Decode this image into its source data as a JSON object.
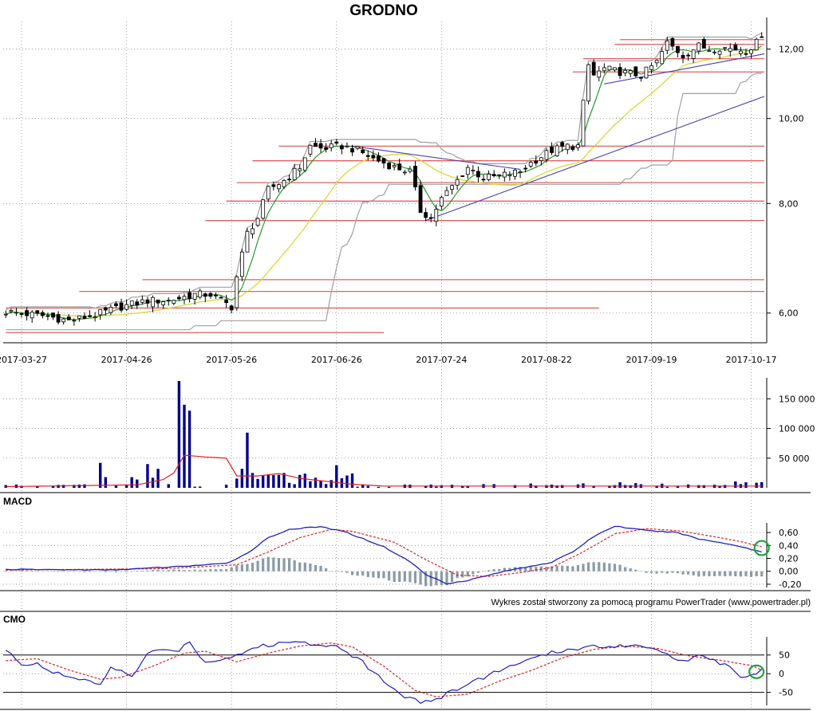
{
  "chart_data": {
    "title": "GRODNO",
    "credit": "Wykres został stworzony za pomocą programu PowerTrader (www.powertrader.pl)",
    "colors": {
      "candle_body_up": "#ffffff",
      "candle_body_down": "#000000",
      "sma_short": "#2a9a2a",
      "sma_long": "#d7d83a",
      "band": "#a0a0a0",
      "support_resistance": "#e06060",
      "trendline": "#4040b0",
      "volume_bar": "#00008b",
      "volume_avg": "#e02020",
      "macd_line": "#2020c0",
      "macd_signal": "#e02020",
      "histogram": "#8a9aa8",
      "marker_circle": "#20a040",
      "grid": "#8a8a8a"
    },
    "price_panel": {
      "type": "candlestick",
      "y_scale": "log",
      "ylim": [
        5.55,
        12.9
      ],
      "y_ticks": [
        6,
        8,
        10,
        12
      ],
      "y_tick_labels": [
        "6,00",
        "8,00",
        "10,00",
        "12,00"
      ],
      "x_tick_labels": [
        "2017-03-27",
        "2017-04-26",
        "2017-05-26",
        "2017-06-26",
        "2017-07-24",
        "2017-08-22",
        "2017-09-19",
        "2017-10-17"
      ],
      "n_sessions": 145,
      "close_anchors": [
        [
          0,
          6.02
        ],
        [
          8,
          5.95
        ],
        [
          12,
          5.88
        ],
        [
          17,
          5.97
        ],
        [
          22,
          6.1
        ],
        [
          27,
          6.2
        ],
        [
          31,
          6.2
        ],
        [
          36,
          6.3
        ],
        [
          39,
          6.3
        ],
        [
          43,
          6.1
        ],
        [
          44,
          6.6
        ],
        [
          46,
          7.4
        ],
        [
          48,
          7.7
        ],
        [
          50,
          8.3
        ],
        [
          53,
          8.5
        ],
        [
          56,
          8.8
        ],
        [
          58,
          9.3
        ],
        [
          60,
          9.25
        ],
        [
          64,
          9.3
        ],
        [
          67,
          9.2
        ],
        [
          70,
          9.0
        ],
        [
          74,
          8.8
        ],
        [
          77,
          8.7
        ],
        [
          79,
          7.85
        ],
        [
          81,
          7.7
        ],
        [
          83,
          8.1
        ],
        [
          86,
          8.5
        ],
        [
          88,
          8.8
        ],
        [
          91,
          8.55
        ],
        [
          94,
          8.6
        ],
        [
          98,
          8.7
        ],
        [
          100,
          8.9
        ],
        [
          104,
          9.2
        ],
        [
          107,
          9.3
        ],
        [
          109,
          9.3
        ],
        [
          110,
          10.4
        ],
        [
          111,
          11.5
        ],
        [
          112,
          11.2
        ],
        [
          114,
          11.4
        ],
        [
          117,
          11.3
        ],
        [
          121,
          11.2
        ],
        [
          124,
          11.6
        ],
        [
          126,
          12.2
        ],
        [
          129,
          11.8
        ],
        [
          132,
          12.1
        ],
        [
          134,
          12.0
        ],
        [
          136,
          12.05
        ],
        [
          139,
          12.0
        ],
        [
          141,
          11.95
        ],
        [
          143,
          12.2
        ],
        [
          144,
          12.5
        ]
      ],
      "support_resistance_levels": [
        {
          "y": 12.3,
          "from": 117,
          "to": 145
        },
        {
          "y": 12.15,
          "from": 116,
          "to": 145
        },
        {
          "y": 11.7,
          "from": 110,
          "to": 145
        },
        {
          "y": 11.3,
          "from": 108,
          "to": 145
        },
        {
          "y": 9.3,
          "from": 52,
          "to": 145
        },
        {
          "y": 8.95,
          "from": 47,
          "to": 145
        },
        {
          "y": 8.45,
          "from": 44,
          "to": 145
        },
        {
          "y": 8.05,
          "from": 42,
          "to": 145
        },
        {
          "y": 7.65,
          "from": 38,
          "to": 145
        },
        {
          "y": 6.55,
          "from": 26,
          "to": 145
        },
        {
          "y": 6.35,
          "from": 14,
          "to": 145
        },
        {
          "y": 6.08,
          "from": 0,
          "to": 113
        },
        {
          "y": 5.7,
          "from": 0,
          "to": 72
        }
      ],
      "trendlines": [
        {
          "from": [
            66,
            9.3
          ],
          "to": [
            98,
            8.75
          ]
        },
        {
          "from": [
            80,
            7.65
          ],
          "to": [
            145,
            10.6
          ]
        },
        {
          "from": [
            114,
            10.95
          ],
          "to": [
            145,
            11.85
          ]
        }
      ]
    },
    "volume_panel": {
      "type": "bar",
      "ylim": [
        0,
        180000
      ],
      "y_ticks": [
        50000,
        100000,
        150000
      ],
      "y_tick_labels": [
        "50 000",
        "100 000",
        "150 000"
      ],
      "spikes": [
        [
          18,
          42000
        ],
        [
          19,
          18000
        ],
        [
          24,
          18000
        ],
        [
          25,
          14000
        ],
        [
          27,
          40000
        ],
        [
          28,
          17000
        ],
        [
          29,
          32000
        ],
        [
          33,
          180000
        ],
        [
          34,
          140000
        ],
        [
          35,
          130000
        ],
        [
          45,
          32000
        ],
        [
          46,
          93000
        ],
        [
          47,
          25000
        ],
        [
          48,
          15000
        ],
        [
          52,
          22000
        ],
        [
          53,
          25000
        ],
        [
          60,
          12000
        ],
        [
          63,
          38000
        ],
        [
          64,
          16000
        ]
      ],
      "avg_anchors": [
        [
          0,
          2000
        ],
        [
          25,
          5000
        ],
        [
          30,
          14000
        ],
        [
          32,
          25000
        ],
        [
          34,
          55000
        ],
        [
          38,
          52000
        ],
        [
          42,
          50000
        ],
        [
          44,
          20000
        ],
        [
          48,
          20000
        ],
        [
          52,
          24000
        ],
        [
          56,
          16000
        ],
        [
          66,
          6000
        ],
        [
          72,
          3000
        ],
        [
          145,
          3000
        ]
      ]
    },
    "macd_panel": {
      "label": "MACD",
      "type": "line",
      "ylim": [
        -0.25,
        0.7
      ],
      "y_ticks": [
        -0.2,
        0,
        0.2,
        0.4,
        0.6
      ],
      "y_tick_labels": [
        "-0,20",
        "0,00",
        "0,20",
        "0,40",
        "0,60"
      ],
      "macd_anchors": [
        [
          0,
          0.03
        ],
        [
          20,
          0.02
        ],
        [
          30,
          0.06
        ],
        [
          42,
          0.12
        ],
        [
          46,
          0.28
        ],
        [
          50,
          0.52
        ],
        [
          54,
          0.65
        ],
        [
          60,
          0.69
        ],
        [
          65,
          0.6
        ],
        [
          72,
          0.38
        ],
        [
          77,
          0.15
        ],
        [
          80,
          -0.05
        ],
        [
          84,
          -0.19
        ],
        [
          88,
          -0.14
        ],
        [
          94,
          -0.02
        ],
        [
          98,
          0.05
        ],
        [
          104,
          0.14
        ],
        [
          108,
          0.3
        ],
        [
          112,
          0.54
        ],
        [
          116,
          0.7
        ],
        [
          122,
          0.63
        ],
        [
          128,
          0.6
        ],
        [
          132,
          0.5
        ],
        [
          138,
          0.42
        ],
        [
          142,
          0.34
        ],
        [
          144,
          0.3
        ]
      ],
      "signal_anchors": [
        [
          0,
          0.02
        ],
        [
          30,
          0.04
        ],
        [
          44,
          0.1
        ],
        [
          50,
          0.3
        ],
        [
          56,
          0.52
        ],
        [
          62,
          0.65
        ],
        [
          66,
          0.62
        ],
        [
          74,
          0.45
        ],
        [
          80,
          0.18
        ],
        [
          86,
          -0.06
        ],
        [
          92,
          -0.08
        ],
        [
          98,
          -0.02
        ],
        [
          104,
          0.06
        ],
        [
          110,
          0.3
        ],
        [
          116,
          0.58
        ],
        [
          122,
          0.66
        ],
        [
          128,
          0.63
        ],
        [
          134,
          0.55
        ],
        [
          140,
          0.46
        ],
        [
          144,
          0.38
        ]
      ],
      "marker_circle_at": [
        144,
        0.36
      ]
    },
    "cmo_panel": {
      "label": "CMO",
      "type": "line",
      "ylim": [
        -85,
        90
      ],
      "y_ticks": [
        -50,
        0,
        50
      ],
      "y_tick_labels": [
        "-50",
        "0",
        "50"
      ],
      "reference_lines": [
        50,
        0,
        -50
      ],
      "cmo_anchors": [
        [
          0,
          62
        ],
        [
          3,
          25
        ],
        [
          6,
          30
        ],
        [
          9,
          2
        ],
        [
          12,
          -8
        ],
        [
          15,
          -20
        ],
        [
          18,
          -30
        ],
        [
          20,
          20
        ],
        [
          24,
          -10
        ],
        [
          27,
          55
        ],
        [
          30,
          62
        ],
        [
          33,
          65
        ],
        [
          35,
          85
        ],
        [
          38,
          30
        ],
        [
          44,
          50
        ],
        [
          48,
          72
        ],
        [
          54,
          85
        ],
        [
          60,
          80
        ],
        [
          64,
          70
        ],
        [
          68,
          30
        ],
        [
          72,
          -20
        ],
        [
          76,
          -60
        ],
        [
          79,
          -75
        ],
        [
          82,
          -70
        ],
        [
          86,
          -40
        ],
        [
          90,
          -15
        ],
        [
          96,
          20
        ],
        [
          100,
          38
        ],
        [
          104,
          55
        ],
        [
          108,
          68
        ],
        [
          112,
          72
        ],
        [
          118,
          76
        ],
        [
          124,
          70
        ],
        [
          128,
          35
        ],
        [
          132,
          45
        ],
        [
          136,
          30
        ],
        [
          140,
          -5
        ],
        [
          143,
          0
        ],
        [
          144,
          15
        ]
      ],
      "signal_anchors": [
        [
          0,
          35
        ],
        [
          6,
          40
        ],
        [
          12,
          10
        ],
        [
          18,
          -15
        ],
        [
          22,
          -10
        ],
        [
          28,
          20
        ],
        [
          34,
          55
        ],
        [
          38,
          60
        ],
        [
          44,
          32
        ],
        [
          50,
          55
        ],
        [
          56,
          74
        ],
        [
          62,
          82
        ],
        [
          66,
          72
        ],
        [
          72,
          20
        ],
        [
          78,
          -45
        ],
        [
          82,
          -62
        ],
        [
          88,
          -55
        ],
        [
          94,
          -20
        ],
        [
          100,
          8
        ],
        [
          106,
          42
        ],
        [
          112,
          65
        ],
        [
          118,
          74
        ],
        [
          124,
          68
        ],
        [
          130,
          48
        ],
        [
          136,
          36
        ],
        [
          142,
          22
        ],
        [
          144,
          10
        ]
      ],
      "marker_circle_at": [
        143,
        5
      ]
    }
  }
}
